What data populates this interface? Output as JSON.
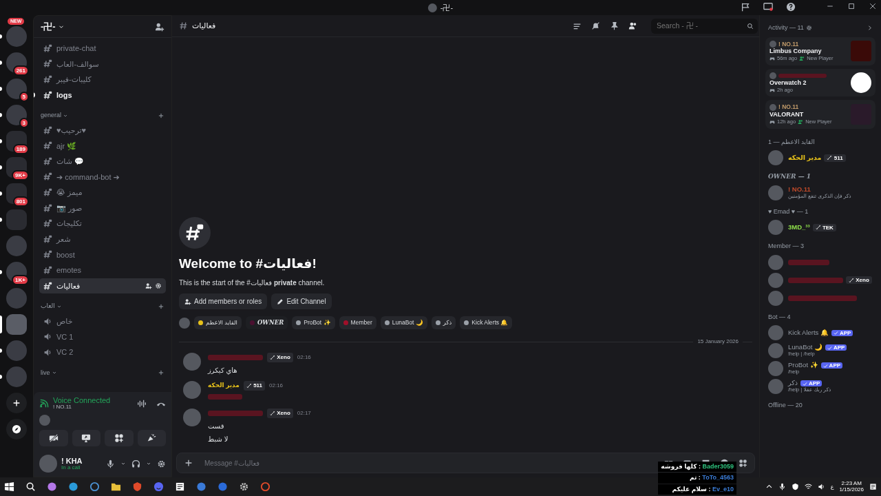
{
  "window": {
    "title": "-卍-"
  },
  "servers": [
    {
      "kind": "server",
      "badge": "NEW",
      "unread": true,
      "selected": false
    },
    {
      "kind": "server",
      "badge": "261",
      "unread": true,
      "selected": false
    },
    {
      "kind": "server",
      "badge": "5",
      "unread": true,
      "selected": false
    },
    {
      "kind": "server",
      "badge": "3",
      "unread": true,
      "selected": false
    },
    {
      "kind": "folder",
      "badge": "189",
      "unread": true,
      "selected": false
    },
    {
      "kind": "folder",
      "badge": "9K+",
      "unread": true,
      "selected": false
    },
    {
      "kind": "folder",
      "badge": "801",
      "unread": true,
      "selected": false
    },
    {
      "kind": "folder",
      "unread": true,
      "selected": false
    },
    {
      "kind": "server",
      "unread": false,
      "selected": false
    },
    {
      "kind": "server",
      "badge": "1K+",
      "unread": true,
      "selected": false
    },
    {
      "kind": "server",
      "unread": false,
      "selected": false
    },
    {
      "kind": "server",
      "unread": false,
      "selected": true
    },
    {
      "kind": "server",
      "unread": true,
      "selected": false
    },
    {
      "kind": "server",
      "unread": true,
      "selected": false
    },
    {
      "kind": "add"
    },
    {
      "kind": "discover"
    }
  ],
  "sidebar": {
    "server_name": "-卍-",
    "sections": [
      {
        "channels": [
          {
            "kind": "text",
            "name": "private-chat",
            "selected": false,
            "unread": false
          },
          {
            "kind": "text",
            "name": "سوالف-العاب",
            "selected": false,
            "unread": false
          },
          {
            "kind": "text",
            "name": "كليبات-فيبر",
            "selected": false,
            "unread": false
          },
          {
            "kind": "text",
            "name": "logs",
            "selected": false,
            "unread": true
          }
        ]
      },
      {
        "category": "general",
        "channels": [
          {
            "kind": "text",
            "name": "♥ترحيب♥",
            "selected": false,
            "unread": false
          },
          {
            "kind": "text",
            "name": "ajr 🌿",
            "selected": false,
            "unread": false
          },
          {
            "kind": "text",
            "name": "شات 💬",
            "selected": false,
            "unread": false
          },
          {
            "kind": "text",
            "name": "➔ command-bot ➔",
            "selected": false,
            "unread": false
          },
          {
            "kind": "text",
            "name": "😭 ميمز",
            "selected": false,
            "unread": false
          },
          {
            "kind": "text",
            "name": "📷 صور",
            "selected": false,
            "unread": false
          },
          {
            "kind": "text",
            "name": "تكليجات",
            "selected": false,
            "unread": false
          },
          {
            "kind": "text",
            "name": "شعر",
            "selected": false,
            "unread": false
          },
          {
            "kind": "text",
            "name": "boost",
            "selected": false,
            "unread": false
          },
          {
            "kind": "text",
            "name": "emotes",
            "selected": false,
            "unread": false
          },
          {
            "kind": "text",
            "name": "فعاليات",
            "selected": true,
            "unread": false
          }
        ]
      },
      {
        "category": "العاب",
        "channels": [
          {
            "kind": "voice",
            "name": "خاص",
            "selected": false,
            "unread": false
          },
          {
            "kind": "voice",
            "name": "VC 1",
            "selected": false,
            "unread": false
          },
          {
            "kind": "voice",
            "name": "VC 2",
            "selected": false,
            "unread": false
          }
        ]
      },
      {
        "category": "live"
      }
    ]
  },
  "voice": {
    "status": "Voice Connected",
    "channel": "! NO.11"
  },
  "user": {
    "name": "! KHA",
    "status": "In a call"
  },
  "chat": {
    "channel": "فعاليات",
    "search_placeholder": "Search - 卍 -",
    "welcome": {
      "title": "Welcome to #فعاليات!",
      "subtitle": "This is the start of the #فعاليات **private** channel.",
      "buttons": [
        {
          "kind": "members",
          "label": "Add members or roles"
        },
        {
          "kind": "edit",
          "label": "Edit Channel"
        }
      ]
    },
    "roles": [
      {
        "label": "القايد الاعظم",
        "color": "#e8c21a",
        "kind": "role"
      },
      {
        "label": "OWNER",
        "color": "#4a1030",
        "kind": "fancy"
      },
      {
        "label": "ProBot ✨",
        "color": "#9aa0a8",
        "kind": "role"
      },
      {
        "label": "Member",
        "color": "#a0102a",
        "kind": "role"
      },
      {
        "label": "LunaBot 🌙",
        "color": "#9aa0a8",
        "kind": "role"
      },
      {
        "label": "ذكر",
        "color": "#9aa0a8",
        "kind": "role"
      },
      {
        "label": "Kick Alerts 🔔",
        "color": "#9aa0a8",
        "kind": "role"
      }
    ],
    "date": "15 January 2026",
    "messages": [
      {
        "author_obscured": true,
        "tag": "Xeno",
        "time": "02:16",
        "lines": [
          "هاي كيكرز"
        ]
      },
      {
        "author": "مدير الحكه",
        "tag": "511",
        "time": "02:16",
        "text_obscured": true
      },
      {
        "author_obscured": true,
        "tag": "Xeno",
        "time": "02:17",
        "lines": [
          "قست",
          "لا شبط"
        ]
      }
    ],
    "composer_placeholder": "Message #فعاليات"
  },
  "members": {
    "activity_label": "Activity — 11",
    "activities": [
      {
        "user": "! NO.11",
        "game": "Limbus Company",
        "ago": "56m ago",
        "badge": "New Player"
      },
      {
        "user_obscured": true,
        "game": "Overwatch 2",
        "ago": "2h ago"
      },
      {
        "user": "! NO.11",
        "game": "VALORANT",
        "ago": "12h ago",
        "badge": "New Player"
      }
    ],
    "groups": [
      {
        "label": "القايد الاعظم — 1",
        "members": [
          {
            "name": "مدير الحكه",
            "tag": "511",
            "color": "#e8c21a"
          }
        ]
      },
      {
        "label": "OWNER — 1",
        "members": [
          {
            "name": "! NO.11",
            "color": "#c04a2a",
            "status": "ذكر فإن الذكرى تنفع المؤمنين"
          }
        ]
      },
      {
        "label": "♥ Emad ♥ — 1",
        "members": [
          {
            "name": "3MD_³³",
            "tag": "TEK",
            "color": "#8fe04a"
          }
        ]
      },
      {
        "label": "Member — 3",
        "members": [
          {
            "name_obscured": true
          },
          {
            "name_obscured": true,
            "tag": "Xeno"
          },
          {
            "name_obscured": true
          }
        ]
      },
      {
        "label": "Bot — 4",
        "members": [
          {
            "name": "Kick Alerts 🔔",
            "app": "APP"
          },
          {
            "name": "LunaBot 🌙",
            "app": "APP",
            "status": "!help | /help"
          },
          {
            "name": "ProBot ✨",
            "app": "APP",
            "status": "/help"
          },
          {
            "name": "ذكر",
            "app": "APP",
            "status": "/help | ذكر ربك عقلا"
          }
        ]
      },
      {
        "label": "Offline — 20"
      }
    ]
  },
  "overlay_chat": [
    {
      "user": "Bader3059",
      "text": "كلها فروشه :",
      "color": "#2ec27e"
    },
    {
      "user": "ToTo_4563",
      "text": "تم :",
      "color": "#3b7dd8"
    },
    {
      "user": "Ev_e10",
      "text": "سلام عليكم :",
      "color": "#3b7dd8"
    }
  ],
  "taskbar": {
    "time": "2:23 AM",
    "date": "1/15/2026",
    "language": "ع"
  }
}
